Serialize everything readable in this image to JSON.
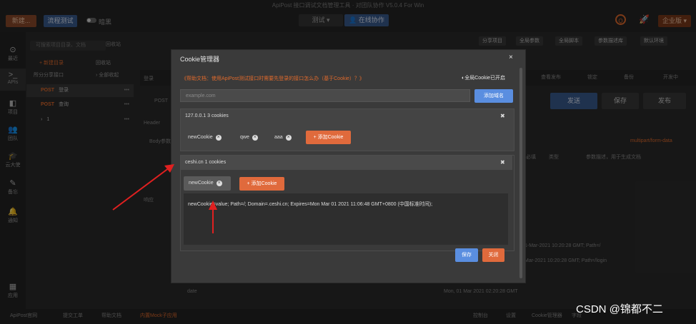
{
  "window": {
    "title": "ApiPost 接口调试文档管理工具 · 对团队协作 V5.0.4 For Win"
  },
  "topbar": {
    "new_label": "新建...",
    "flow_test_label": "流程测试",
    "theme_label": "暗黑",
    "env_label": "测试",
    "collab_label": "在线协作",
    "enterprise_label": "企业版"
  },
  "leftnav": {
    "items": [
      {
        "icon": "⊙",
        "label": "最近"
      },
      {
        "icon": ">_",
        "label": "APIs"
      },
      {
        "icon": "◧",
        "label": "项目"
      },
      {
        "icon": "👥",
        "label": "团队"
      },
      {
        "icon": "🎓",
        "label": "云大使"
      },
      {
        "icon": "✎",
        "label": "备忘"
      },
      {
        "icon": "🔔",
        "label": "通知"
      },
      {
        "icon": "▦",
        "label": "应用"
      }
    ]
  },
  "sidebar": {
    "search_placeholder": "可搜索项目目录、文档",
    "recycle_label": "回收站",
    "new_dir_label": "+ 新建目录",
    "trash_label": "回收站",
    "shared_label": "所分分享接口",
    "expand_label": "› 全部收起",
    "items": [
      {
        "method": "POST",
        "name": "登录"
      },
      {
        "method": "POST",
        "name": "查询"
      },
      {
        "method": "›",
        "name": "1"
      }
    ]
  },
  "main_toolbar": {
    "share_label": "分享项目",
    "params_label": "全局参数",
    "script_label": "全局脚本",
    "db_label": "参数描述库",
    "env_label": "默认环境",
    "publish_label": "查看发布",
    "lock_label": "锁定",
    "backup_label": "备份",
    "dev_label": "开发中",
    "save_tab_label": "登录",
    "method_label": "POST",
    "send_label": "发送",
    "save_label": "保存",
    "publish_btn_label": "发布",
    "header_label": "Header",
    "body_label": "Body参数",
    "form_type": "multipart/form-data",
    "required_label": "必填",
    "type_label": "类型",
    "desc_placeholder": "参数描述，用于生成文档",
    "resp_label": "响应",
    "date_label": "date",
    "date_value": "Mon, 01 Mar 2021 02:20:28 GMT",
    "cookie_line1": "1-Mar-2021 10:20:28 GMT; Path=/",
    "cookie_line2": "Mar-2021 10:20:28 GMT; Path=/login"
  },
  "statusbar": {
    "left": [
      "ApiPost官网",
      "提交工单",
      "帮助文档",
      "内置Mock子应用"
    ],
    "right": [
      "控制台",
      "设置",
      "Cookie管理器",
      "字段"
    ]
  },
  "modal": {
    "title": "Cookie管理器",
    "close": "×",
    "help_text": "《帮助文档：使用ApiPost测试接口时需要先登录的接口怎么办（基于Cookie）？》",
    "global_toggle": "全局Cookie已开启",
    "domain_placeholder": "example.com",
    "add_domain_label": "添加域名",
    "domains": [
      {
        "title": "127.0.0.1  3 cookies",
        "cookies": [
          "newCookie",
          "qwe",
          "aaa"
        ],
        "add_label": "+ 添加Cookie"
      },
      {
        "title": "ceshi.cn  1 cookies",
        "cookies": [
          "newCookie"
        ],
        "add_label": "+ 添加Cookie",
        "detail": "newCookie=value; Path=/; Domain=.ceshi.cn; Expires=Mon Mar 01 2021 11:06:48 GMT+0800 (中国标准时间);"
      }
    ],
    "save_label": "保存",
    "close_label": "关闭"
  },
  "watermark": "CSDN @锦都不二",
  "colors": {
    "accent": "#e06a3c",
    "primary": "#5a8ee0",
    "arrow": "#e02020"
  }
}
